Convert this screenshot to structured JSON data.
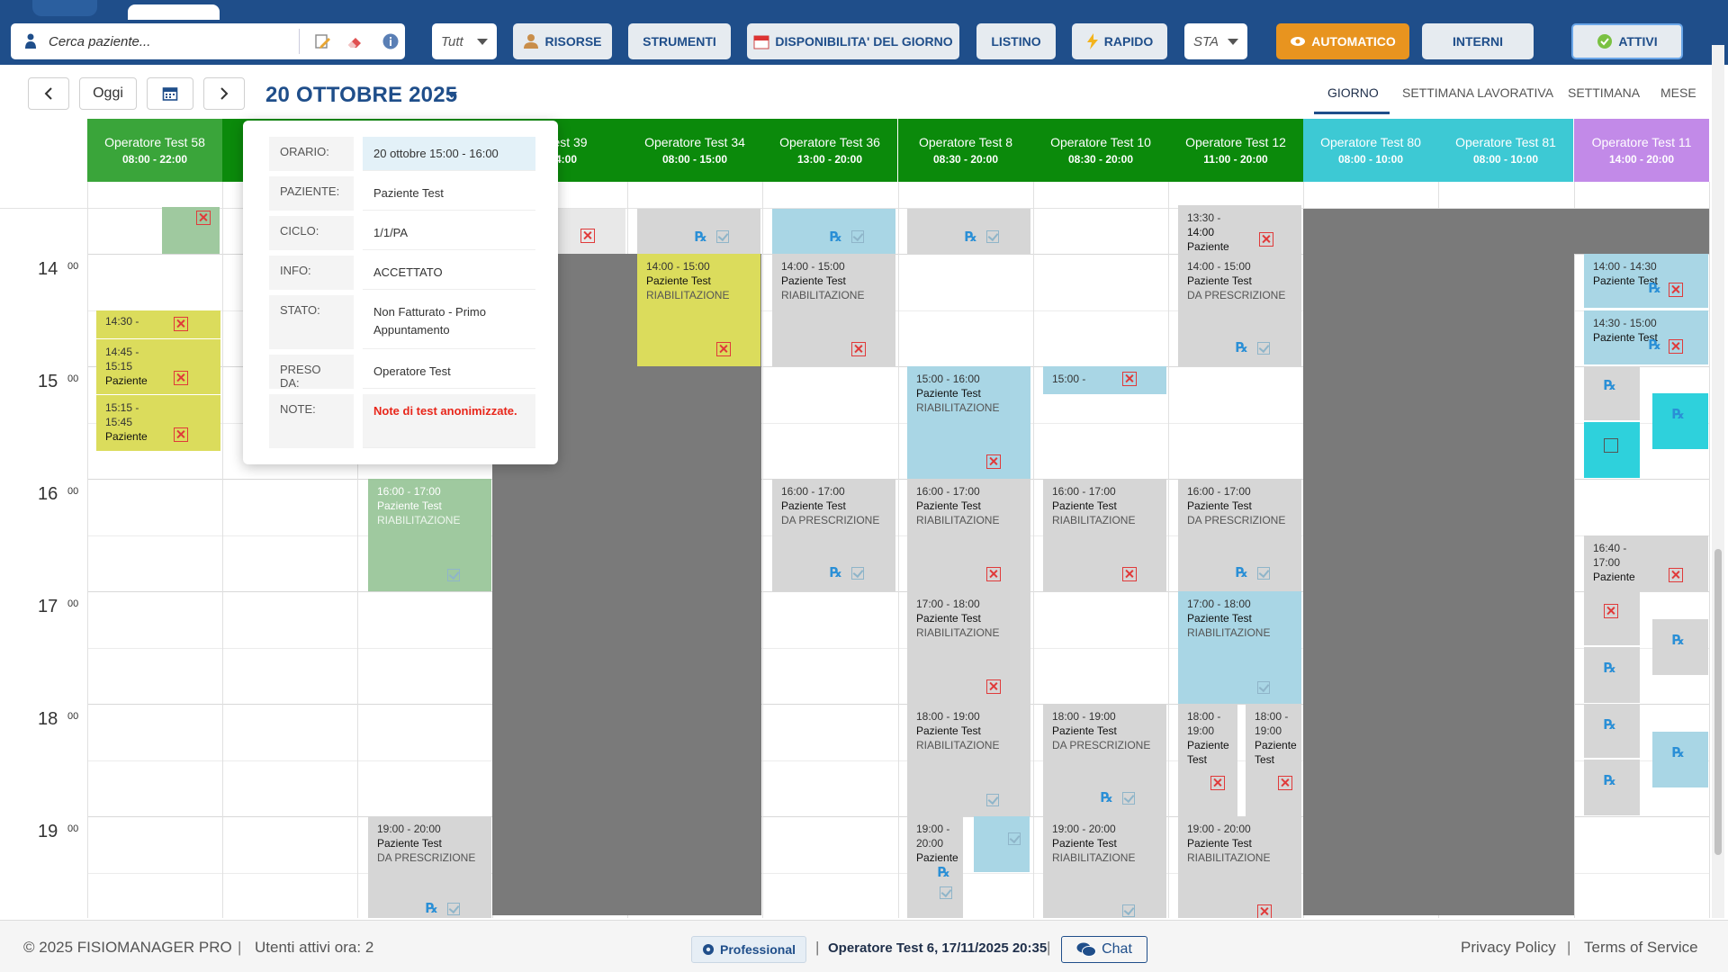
{
  "toolbar": {
    "search_placeholder": "Cerca paziente...",
    "filter_all": "Tutt",
    "risorse": "RISORSE",
    "strumenti": "STRUMENTI",
    "disponibilita": "DISPONIBILITA' DEL GIORNO",
    "listino": "LISTINO",
    "rapido": "RAPIDO",
    "sta": "STA",
    "automatico": "AUTOMATICO",
    "interni": "INTERNI",
    "attivi": "ATTIVI"
  },
  "nav": {
    "today": "Oggi",
    "date_title": "20 OTTOBRE 2025",
    "views": [
      "GIORNO",
      "SETTIMANA LAVORATIVA",
      "SETTIMANA",
      "MESE"
    ],
    "active_view": "GIORNO"
  },
  "operators": [
    {
      "name": "Operatore Test 58",
      "hours": "08:00 - 22:00",
      "color": "#3aa53a"
    },
    {
      "name": "O",
      "hours": "",
      "color": "#0b8a0b"
    },
    {
      "name": "",
      "hours": "",
      "color": "#0b8a0b"
    },
    {
      "name": "re Test 39",
      "hours": "- 14:00",
      "color": "#0b8a0b"
    },
    {
      "name": "Operatore Test 34",
      "hours": "08:00 - 15:00",
      "color": "#0b8a0b"
    },
    {
      "name": "Operatore Test 36",
      "hours": "13:00 - 20:00",
      "color": "#0b8a0b"
    },
    {
      "name": "Operatore Test 8",
      "hours": "08:30 - 20:00",
      "color": "#0b8a0b"
    },
    {
      "name": "Operatore Test 10",
      "hours": "08:30 - 20:00",
      "color": "#0b8a0b"
    },
    {
      "name": "Operatore Test 12",
      "hours": "11:00 - 20:00",
      "color": "#0b8a0b"
    },
    {
      "name": "Operatore Test 80",
      "hours": "08:00 - 10:00",
      "color": "#3dc9d4"
    },
    {
      "name": "Operatore Test 81",
      "hours": "08:00 - 10:00",
      "color": "#3dc9d4"
    },
    {
      "name": "Operatore Test 11",
      "hours": "14:00 - 20:00",
      "color": "#c28ae8"
    }
  ],
  "hours": [
    {
      "h": "14",
      "m": "00"
    },
    {
      "h": "15",
      "m": "00"
    },
    {
      "h": "16",
      "m": "00"
    },
    {
      "h": "17",
      "m": "00"
    },
    {
      "h": "18",
      "m": "00"
    },
    {
      "h": "19",
      "m": "00"
    }
  ],
  "appointments": [
    {
      "time": "14:30 -",
      "patient": "14:45",
      "type": ""
    },
    {
      "time": "14:45 -",
      "patient": "15:15",
      "type": "Paziente"
    },
    {
      "time": "15:15 -",
      "patient": "15:45",
      "type": "Paziente"
    },
    {
      "time": "14:00 - 15:00",
      "patient": "Paziente Test",
      "type": "RIABILITAZIONE"
    },
    {
      "time": "14:00 - 15:00",
      "patient": "Paziente Test",
      "type": "RIABILITAZIONE"
    },
    {
      "time": "13:30 -",
      "patient": "14:00",
      "type": "Paziente"
    },
    {
      "time": "14:00 - 15:00",
      "patient": "Paziente Test",
      "type": "DA PRESCRIZIONE"
    },
    {
      "time": "14:00 - 14:30",
      "patient": "Paziente Test",
      "type": ""
    },
    {
      "time": "14:30 - 15:00",
      "patient": "Paziente Test",
      "type": ""
    },
    {
      "time": "15:00 - 16:00",
      "patient": "Paziente Test",
      "type": "RIABILITAZIONE"
    },
    {
      "time": "15:00 -",
      "patient": "",
      "type": ""
    },
    {
      "time": "16:00 - 17:00",
      "patient": "Paziente Test",
      "type": "RIABILITAZIONE"
    },
    {
      "time": "16:00 - 17:00",
      "patient": "Paziente Test",
      "type": "DA PRESCRIZIONE"
    },
    {
      "time": "16:00 - 17:00",
      "patient": "Paziente Test",
      "type": "RIABILITAZIONE"
    },
    {
      "time": "16:00 - 17:00",
      "patient": "Paziente Test",
      "type": "RIABILITAZIONE"
    },
    {
      "time": "16:00 - 17:00",
      "patient": "Paziente Test",
      "type": "DA PRESCRIZIONE"
    },
    {
      "time": "16:40 -",
      "patient": "17:00",
      "type": "Paziente"
    },
    {
      "time": "17:00 - 18:00",
      "patient": "Paziente Test",
      "type": "RIABILITAZIONE"
    },
    {
      "time": "17:00 - 18:00",
      "patient": "Paziente Test",
      "type": "RIABILITAZIONE"
    },
    {
      "time": "18:00 - 19:00",
      "patient": "Paziente Test",
      "type": "RIABILITAZIONE"
    },
    {
      "time": "18:00 - 19:00",
      "patient": "Paziente Test",
      "type": "DA PRESCRIZIONE"
    },
    {
      "time": "18:00 -",
      "patient": "19:00",
      "type": "Paziente Test"
    },
    {
      "time": "18:00 -",
      "patient": "19:00",
      "type": "Paziente Test"
    },
    {
      "time": "19:00 - 20:00",
      "patient": "Paziente Test",
      "type": "DA PRESCRIZIONE"
    },
    {
      "time": "19:00 -",
      "patient": "20:00",
      "type": "Paziente"
    },
    {
      "time": "19:00 - 20:00",
      "patient": "Paziente Test",
      "type": "RIABILITAZIONE"
    },
    {
      "time": "19:00 - 20:00",
      "patient": "Paziente Test",
      "type": "RIABILITAZIONE"
    }
  ],
  "popup": {
    "rows": [
      {
        "label": "ORARIO:",
        "value": "20 ottobre 15:00 - 16:00"
      },
      {
        "label": "PAZIENTE:",
        "value": "Paziente Test"
      },
      {
        "label": "CICLO:",
        "value": "1/1/PA"
      },
      {
        "label": "INFO:",
        "value": "ACCETTATO"
      },
      {
        "label": "STATO:",
        "value": "Non Fatturato - Primo Appuntamento"
      },
      {
        "label": "PRESO DA:",
        "value": "Operatore Test"
      },
      {
        "label": "NOTE:",
        "value": "Note di test anonimizzate."
      }
    ]
  },
  "footer": {
    "copyright": "© 2025 FISIOMANAGER PRO",
    "active_users": "Utenti attivi ora: 2",
    "plan": "Professional",
    "session": "Operatore Test 6, 17/11/2025 20:35",
    "chat": "Chat",
    "privacy": "Privacy Policy",
    "terms": "Terms of Service"
  },
  "colors": {
    "brand": "#1f4e8a",
    "orange": "#e8941f",
    "appt_grey": "#d6d6d6",
    "appt_blue": "#a9d6e5",
    "appt_yellow": "#dbdc5c",
    "appt_green": "#9fc99f",
    "blocked": "#7a7a7a",
    "note_red": "#e8261a"
  }
}
